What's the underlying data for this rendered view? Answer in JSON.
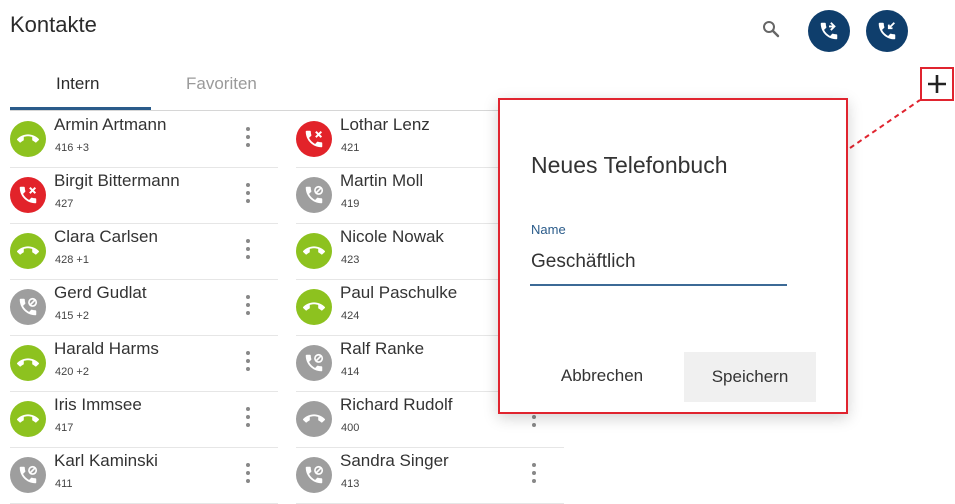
{
  "header": {
    "title": "Kontakte"
  },
  "tabs": [
    {
      "label": "Intern"
    },
    {
      "label": "Favoriten"
    }
  ],
  "contacts_left": [
    {
      "name": "Armin Artmann",
      "ext": "416 +3",
      "status": "green"
    },
    {
      "name": "Birgit Bittermann",
      "ext": "427",
      "status": "red"
    },
    {
      "name": "Clara Carlsen",
      "ext": "428 +1",
      "status": "green"
    },
    {
      "name": "Gerd Gudlat",
      "ext": "415 +2",
      "status": "gray"
    },
    {
      "name": "Harald Harms",
      "ext": "420 +2",
      "status": "green"
    },
    {
      "name": "Iris Immsee",
      "ext": "417",
      "status": "green"
    },
    {
      "name": "Karl Kaminski",
      "ext": "411",
      "status": "gray"
    }
  ],
  "contacts_right": [
    {
      "name": "Lothar Lenz",
      "ext": "421",
      "status": "red"
    },
    {
      "name": "Martin Moll",
      "ext": "419",
      "status": "gray"
    },
    {
      "name": "Nicole Nowak",
      "ext": "423",
      "status": "green"
    },
    {
      "name": "Paul Paschulke",
      "ext": "424",
      "status": "green"
    },
    {
      "name": "Ralf Ranke",
      "ext": "414",
      "status": "gray"
    },
    {
      "name": "Richard Rudolf",
      "ext": "400",
      "status": "gray-idle"
    },
    {
      "name": "Sandra Singer",
      "ext": "413",
      "status": "gray"
    }
  ],
  "dialog": {
    "title": "Neues Telefonbuch",
    "field_label": "Name",
    "field_value": "Geschäftlich",
    "cancel_label": "Abbrechen",
    "save_label": "Speichern"
  },
  "icons": {
    "search": "search-icon",
    "call_forward": "phone-forward-icon",
    "call_back": "phone-callback-icon",
    "add": "plus-icon",
    "menu": "more-vert-icon"
  },
  "colors": {
    "accent": "#0f3e6c",
    "available": "#8dc21f",
    "busy": "#e2232a",
    "offline": "#9e9e9e",
    "highlight": "#e0242f"
  }
}
